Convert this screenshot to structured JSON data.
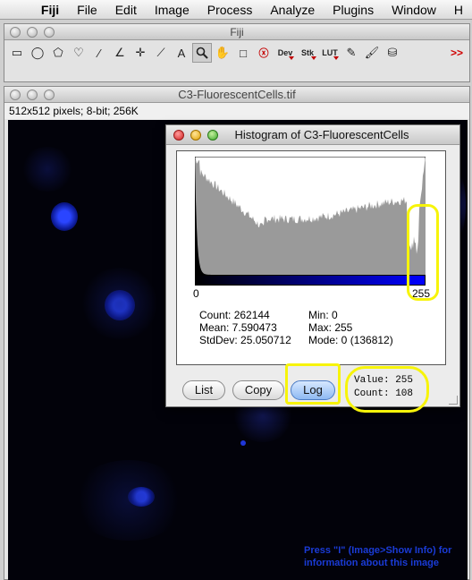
{
  "menubar": {
    "items": [
      "Fiji",
      "File",
      "Edit",
      "Image",
      "Process",
      "Analyze",
      "Plugins",
      "Window",
      "H"
    ]
  },
  "toolbar_window": {
    "title": "Fiji",
    "tools": [
      {
        "name": "rectangle-tool-icon",
        "glyph": "▭"
      },
      {
        "name": "oval-tool-icon",
        "glyph": "◯"
      },
      {
        "name": "polygon-tool-icon",
        "glyph": "⬠"
      },
      {
        "name": "freehand-tool-icon",
        "glyph": "♡"
      },
      {
        "name": "line-tool-icon",
        "glyph": "∕"
      },
      {
        "name": "angle-tool-icon",
        "glyph": "∠"
      },
      {
        "name": "point-tool-icon",
        "glyph": "✛"
      },
      {
        "name": "wand-tool-icon",
        "glyph": "⟋"
      },
      {
        "name": "text-tool-icon",
        "glyph": "A"
      },
      {
        "name": "magnifier-tool-icon",
        "glyph": "🔍"
      },
      {
        "name": "hand-tool-icon",
        "glyph": "✋"
      },
      {
        "name": "color-picker-icon",
        "glyph": "□"
      },
      {
        "name": "close-all-icon",
        "glyph": "ⓧ"
      }
    ],
    "dev_label": "Dev",
    "stk_label": "Stk",
    "lut_label": "LUT",
    "more_label": ">>"
  },
  "image_window": {
    "title": "C3-FluorescentCells.tif",
    "info": "512x512 pixels; 8-bit; 256K",
    "note": "Press \"I\" (Image>Show Info) for information about this image"
  },
  "histogram_window": {
    "title": "Histogram of C3-FluorescentCells",
    "axis_min": "0",
    "axis_max": "255",
    "stats": {
      "count": "Count: 262144",
      "mean": "Mean: 7.590473",
      "stddev": "StdDev: 25.050712",
      "min": "Min: 0",
      "max": "Max: 255",
      "mode": "Mode: 0 (136812)"
    },
    "buttons": {
      "list": "List",
      "copy": "Copy",
      "log": "Log"
    },
    "value": "Value: 255",
    "count": "Count: 108"
  },
  "colors": {
    "highlight": "#f7f40a",
    "hist_fill": "#9a9a9a",
    "note_text": "#1a3bd6"
  }
}
